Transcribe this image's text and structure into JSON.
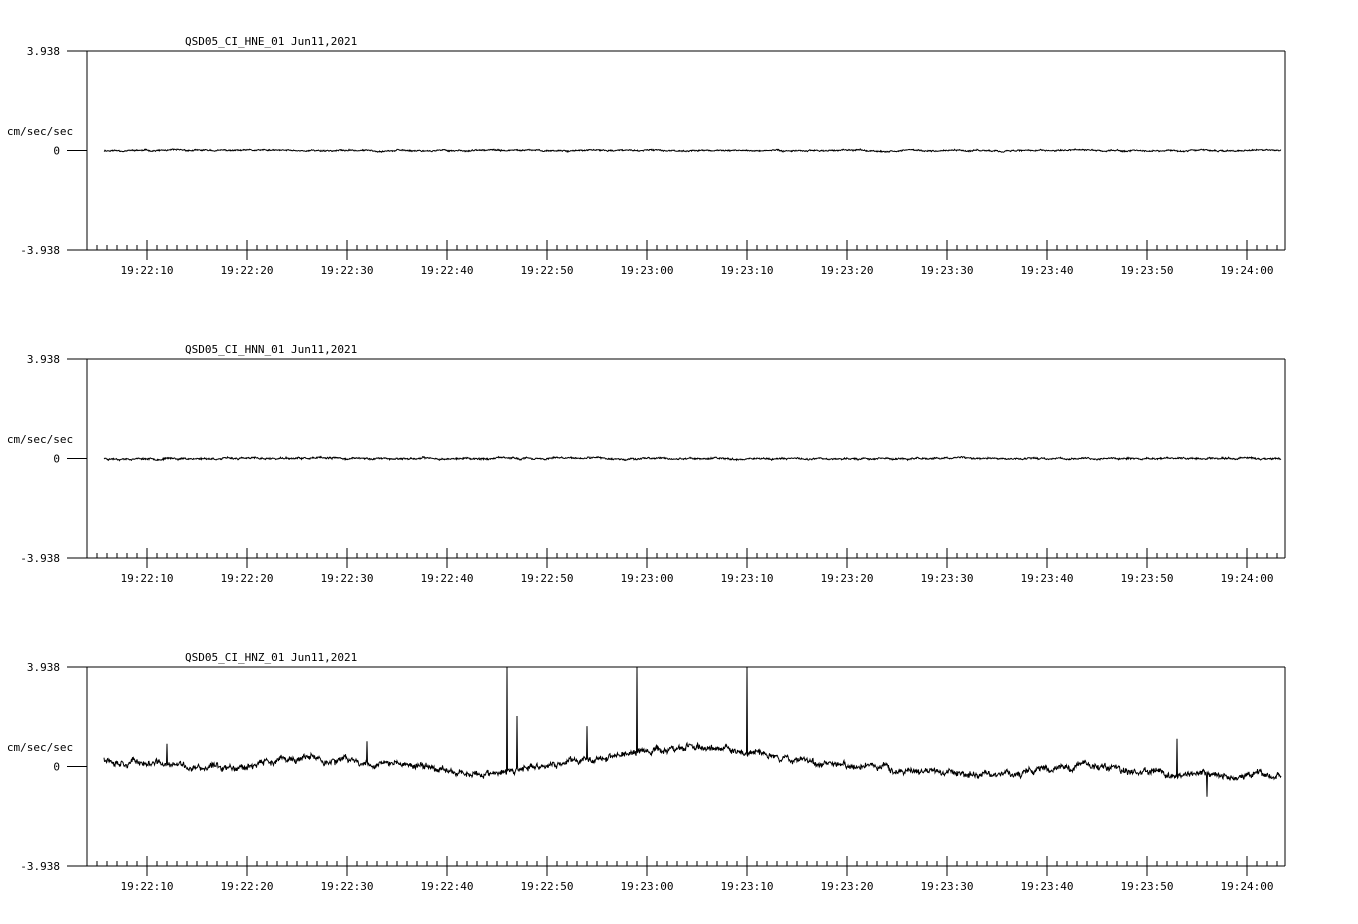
{
  "chart_data": [
    {
      "type": "line",
      "title": "QSD05_CI_HNE_01  Jun11,2021",
      "ylabel": "cm/sec/sec",
      "ytick_labels": [
        "3.938",
        "0",
        "-3.938"
      ],
      "ylim": [
        -3.938,
        3.938
      ],
      "x_start": "19:22:04",
      "x_end": "19:24:03",
      "xtick_labels": [
        "19:22:10",
        "19:22:20",
        "19:22:30",
        "19:22:40",
        "19:22:50",
        "19:23:00",
        "19:23:10",
        "19:23:20",
        "19:23:30",
        "19:23:40",
        "19:23:50",
        "19:24:00"
      ],
      "series": [
        {
          "color": "#000000",
          "trace_seed": 11,
          "noise": 0.04,
          "baseline": [
            0,
            0,
            0,
            0,
            0,
            0,
            0,
            0,
            0,
            0,
            0,
            0,
            0
          ],
          "spikes": []
        }
      ]
    },
    {
      "type": "line",
      "title": "QSD05_CI_HNN_01  Jun11,2021",
      "ylabel": "cm/sec/sec",
      "ytick_labels": [
        "3.938",
        "0",
        "-3.938"
      ],
      "ylim": [
        -3.938,
        3.938
      ],
      "x_start": "19:22:04",
      "x_end": "19:24:03",
      "xtick_labels": [
        "19:22:10",
        "19:22:20",
        "19:22:30",
        "19:22:40",
        "19:22:50",
        "19:23:00",
        "19:23:10",
        "19:23:20",
        "19:23:30",
        "19:23:40",
        "19:23:50",
        "19:24:00"
      ],
      "series": [
        {
          "color": "#000000",
          "trace_seed": 23,
          "noise": 0.05,
          "baseline": [
            0,
            0,
            0,
            0,
            0,
            0,
            0,
            0,
            0,
            0,
            0,
            0,
            0
          ],
          "spikes": []
        }
      ]
    },
    {
      "type": "line",
      "title": "QSD05_CI_HNZ_01  Jun11,2021",
      "ylabel": "cm/sec/sec",
      "ytick_labels": [
        "3.938",
        "0",
        "-3.938"
      ],
      "ylim": [
        -3.938,
        3.938
      ],
      "x_start": "19:22:04",
      "x_end": "19:24:03",
      "xtick_labels": [
        "19:22:10",
        "19:22:20",
        "19:22:30",
        "19:22:40",
        "19:22:50",
        "19:23:00",
        "19:23:10",
        "19:23:20",
        "19:23:30",
        "19:23:40",
        "19:23:50",
        "19:24:00"
      ],
      "series": [
        {
          "color": "#000000",
          "trace_seed": 37,
          "noise": 0.18,
          "baseline": [
            0.35,
            -0.1,
            0.3,
            0.1,
            -0.35,
            0.35,
            0.8,
            0.35,
            -0.1,
            -0.35,
            0.1,
            -0.4,
            -0.35
          ],
          "spikes": [
            {
              "t": "19:22:46",
              "value": 3.938
            },
            {
              "t": "19:22:47",
              "value": 2.0
            },
            {
              "t": "19:22:54",
              "value": 1.6
            },
            {
              "t": "19:22:59",
              "value": 3.938
            },
            {
              "t": "19:23:10",
              "value": 3.938
            },
            {
              "t": "19:22:12",
              "value": 0.9
            },
            {
              "t": "19:22:32",
              "value": 1.0
            },
            {
              "t": "19:23:53",
              "value": 1.1
            },
            {
              "t": "19:23:56",
              "value": -1.2
            }
          ]
        }
      ]
    }
  ]
}
